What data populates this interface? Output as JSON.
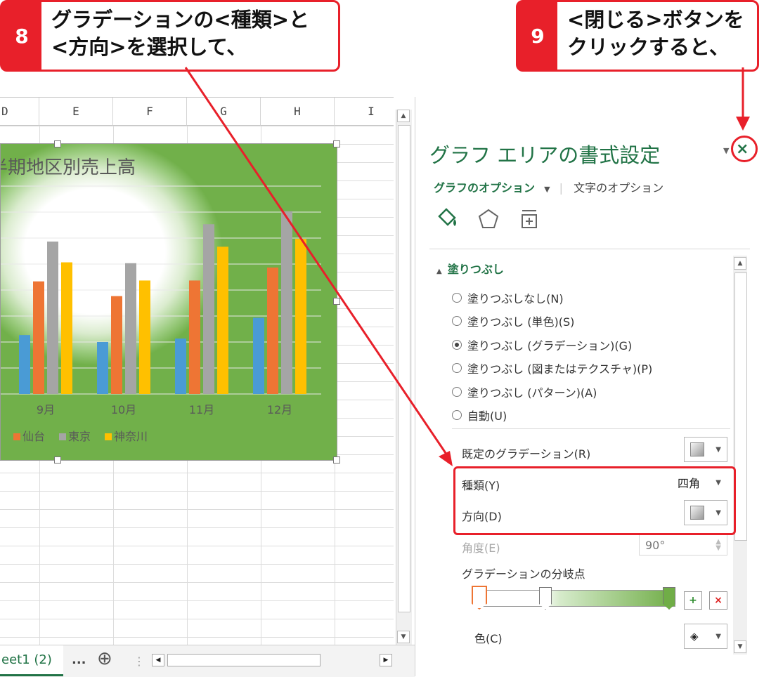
{
  "callouts": [
    {
      "num": "8",
      "text": "グラデーションの<種類>と\n<方向>を選択して、"
    },
    {
      "num": "9",
      "text": "<閉じる>ボタンを\nクリックすると、"
    }
  ],
  "sheet": {
    "columns": [
      "D",
      "E",
      "F",
      "G",
      "H",
      "I"
    ],
    "tab_label": "eet1 (2)",
    "more_tabs": "...",
    "add_sheet": "⊕"
  },
  "chart_data": {
    "type": "bar",
    "title": "半期地区別売上高",
    "categories": [
      "9月",
      "10月",
      "11月",
      "12月"
    ],
    "series": [
      {
        "name": "",
        "color": "#4a9bd5",
        "values": [
          68,
          60,
          64,
          88
        ]
      },
      {
        "name": "仙台",
        "color": "#ee7534",
        "values": [
          130,
          113,
          131,
          146
        ]
      },
      {
        "name": "東京",
        "color": "#a5a5a5",
        "values": [
          176,
          151,
          196,
          211
        ]
      },
      {
        "name": "神奈川",
        "color": "#ffc000",
        "values": [
          152,
          131,
          170,
          179
        ]
      }
    ],
    "ylim": [
      0,
      240
    ],
    "grid": true
  },
  "pane": {
    "title": "グラフ エリアの書式設定",
    "tab_graph": "グラフのオプション",
    "tab_text": "文字のオプション",
    "section": "塗りつぶし",
    "options": [
      {
        "label": "塗りつぶしなし(N)",
        "selected": false
      },
      {
        "label": "塗りつぶし (単色)(S)",
        "selected": false
      },
      {
        "label": "塗りつぶし (グラデーション)(G)",
        "selected": true
      },
      {
        "label": "塗りつぶし (図またはテクスチャ)(P)",
        "selected": false
      },
      {
        "label": "塗りつぶし (パターン)(A)",
        "selected": false
      },
      {
        "label": "自動(U)",
        "selected": false
      }
    ],
    "preset_label": "既定のグラデーション(R)",
    "type_label": "種類(Y)",
    "type_value": "四角",
    "direction_label": "方向(D)",
    "angle_label": "角度(E)",
    "angle_value": "90°",
    "stops_label": "グラデーションの分岐点",
    "color_label": "色(C)",
    "close_icon": "×"
  },
  "colors": {
    "accent": "#217346",
    "callout": "#e8202a"
  }
}
